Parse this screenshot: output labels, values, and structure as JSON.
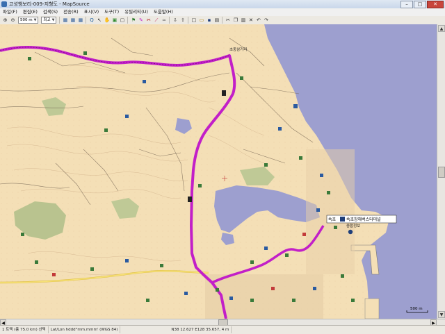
{
  "window": {
    "title": "고성행보리-009-지형도 - MapSource",
    "min_label": "–",
    "max_label": "□",
    "close_label": "✕"
  },
  "menu": [
    "파일(F)",
    "편집(E)",
    "검색(S)",
    "전송(R)",
    "표시(V)",
    "도구(T)",
    "유틸리티(U)",
    "도움말(H)"
  ],
  "toolbar": {
    "zoom_value": "500 m",
    "detail_value": "최고"
  },
  "map": {
    "label_bus_terminal": "속초창해버스터미널",
    "label_callout_left": "속초",
    "label_bus_sub": "종합정보",
    "label_intersection": "초중삼거리",
    "scale_label": "500 m",
    "colors": {
      "land": "#f4dfb6",
      "sea": "#9d9fcf",
      "route": "#c21fc8"
    }
  },
  "status": {
    "route_info": "1 트랙 (총 75.0 km) 선택",
    "position_format": "Lat/Lon hddd°mm.mmm' (WGS 84)",
    "coordinates": "N38 12.627 E128 35.657, 4 m"
  }
}
